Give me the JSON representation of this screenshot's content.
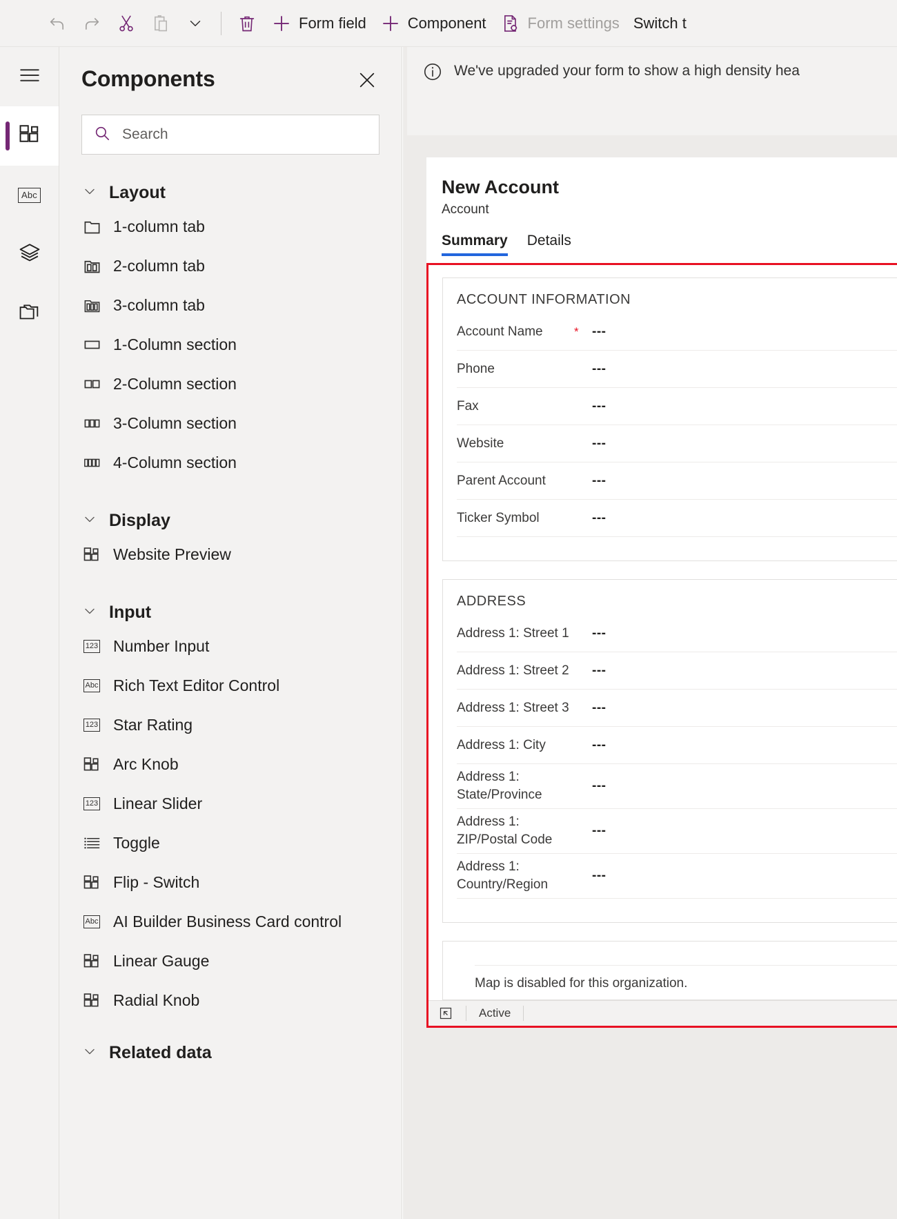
{
  "command_bar": {
    "buttons": [
      {
        "id": "undo",
        "label": "",
        "icon": "undo-icon",
        "disabled": true
      },
      {
        "id": "redo",
        "label": "",
        "icon": "redo-icon",
        "disabled": true
      },
      {
        "id": "cut",
        "label": "",
        "icon": "cut-icon",
        "disabled": false
      },
      {
        "id": "paste",
        "label": "",
        "icon": "paste-icon",
        "disabled": true
      },
      {
        "id": "paste-more",
        "label": "",
        "icon": "chevron-down-icon",
        "disabled": false
      },
      {
        "id": "delete",
        "label": "",
        "icon": "trash-icon",
        "disabled": false
      },
      {
        "id": "form-field",
        "label": "Form field",
        "icon": "plus-icon",
        "disabled": false
      },
      {
        "id": "component",
        "label": "Component",
        "icon": "plus-icon",
        "disabled": false
      },
      {
        "id": "form-settings",
        "label": "Form settings",
        "icon": "form-settings-icon",
        "disabled": true
      },
      {
        "id": "switch",
        "label": "Switch t",
        "icon": "none",
        "disabled": false
      }
    ]
  },
  "rail": {
    "hamburger_label": "hamburger-menu",
    "items": [
      {
        "id": "components",
        "icon": "components-grid-icon",
        "active": true
      },
      {
        "id": "table-columns",
        "icon": "abc-icon",
        "active": false
      },
      {
        "id": "layers",
        "icon": "layers-icon",
        "active": false
      },
      {
        "id": "copy",
        "icon": "copy-folder-icon",
        "active": false
      }
    ]
  },
  "panel": {
    "title": "Components",
    "close_label": "close-panel",
    "search": {
      "placeholder": "Search",
      "value": ""
    },
    "groups": [
      {
        "label": "Layout",
        "expanded": true,
        "items": [
          {
            "label": "1-column tab",
            "icon": "tab-1col-icon"
          },
          {
            "label": "2-column tab",
            "icon": "tab-2col-icon"
          },
          {
            "label": "3-column tab",
            "icon": "tab-3col-icon"
          },
          {
            "label": "1-Column section",
            "icon": "section-1col-icon"
          },
          {
            "label": "2-Column section",
            "icon": "section-2col-icon"
          },
          {
            "label": "3-Column section",
            "icon": "section-3col-icon"
          },
          {
            "label": "4-Column section",
            "icon": "section-4col-icon"
          }
        ]
      },
      {
        "label": "Display",
        "expanded": true,
        "items": [
          {
            "label": "Website Preview",
            "icon": "component-grid-icon"
          }
        ]
      },
      {
        "label": "Input",
        "expanded": true,
        "items": [
          {
            "label": "Number Input",
            "icon": "number-123-icon"
          },
          {
            "label": "Rich Text Editor Control",
            "icon": "abc-icon"
          },
          {
            "label": "Star Rating",
            "icon": "number-123-icon"
          },
          {
            "label": "Arc Knob",
            "icon": "component-grid-icon"
          },
          {
            "label": "Linear Slider",
            "icon": "number-123-icon"
          },
          {
            "label": "Toggle",
            "icon": "list-icon"
          },
          {
            "label": "Flip - Switch",
            "icon": "component-grid-icon"
          },
          {
            "label": "AI Builder Business Card control",
            "icon": "abc-icon"
          },
          {
            "label": "Linear Gauge",
            "icon": "component-grid-icon"
          },
          {
            "label": "Radial Knob",
            "icon": "component-grid-icon"
          }
        ]
      },
      {
        "label": "Related data",
        "expanded": true,
        "items": []
      }
    ]
  },
  "canvas": {
    "notification": {
      "icon": "info-icon",
      "text": "We've upgraded your form to show a high density hea"
    },
    "form": {
      "title": "New Account",
      "subtitle": "Account",
      "tabs": [
        {
          "label": "Summary",
          "active": true
        },
        {
          "label": "Details",
          "active": false
        }
      ],
      "selection_color": "#e81123",
      "tab_accent_color": "#2266dd",
      "sections": [
        {
          "title": "ACCOUNT INFORMATION",
          "fields": [
            {
              "label": "Account Name",
              "required": true,
              "value": "---"
            },
            {
              "label": "Phone",
              "required": false,
              "value": "---"
            },
            {
              "label": "Fax",
              "required": false,
              "value": "---"
            },
            {
              "label": "Website",
              "required": false,
              "value": "---"
            },
            {
              "label": "Parent Account",
              "required": false,
              "value": "---"
            },
            {
              "label": "Ticker Symbol",
              "required": false,
              "value": "---"
            }
          ]
        },
        {
          "title": "ADDRESS",
          "fields": [
            {
              "label": "Address 1: Street 1",
              "required": false,
              "value": "---"
            },
            {
              "label": "Address 1: Street 2",
              "required": false,
              "value": "---"
            },
            {
              "label": "Address 1: Street 3",
              "required": false,
              "value": "---"
            },
            {
              "label": "Address 1: City",
              "required": false,
              "value": "---"
            },
            {
              "label": "Address 1: State/Province",
              "required": false,
              "value": "---"
            },
            {
              "label": "Address 1: ZIP/Postal Code",
              "required": false,
              "value": "---"
            },
            {
              "label": "Address 1: Country/Region",
              "required": false,
              "value": "---"
            }
          ]
        }
      ],
      "map_message": "Map is disabled for this organization.",
      "status_bar": {
        "icon": "expand-icon",
        "text": "Active"
      }
    }
  }
}
